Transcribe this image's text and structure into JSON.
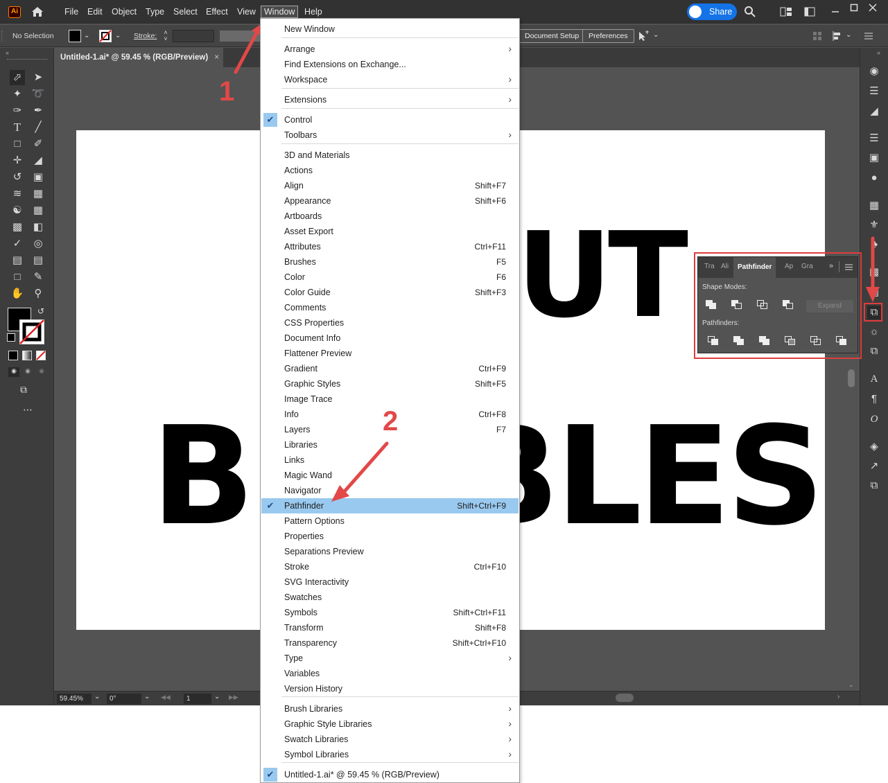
{
  "app": {
    "logo": "Ai",
    "menus": [
      "File",
      "Edit",
      "Object",
      "Type",
      "Select",
      "Effect",
      "View",
      "Window",
      "Help"
    ],
    "share_label": "Share"
  },
  "control_bar": {
    "selection": "No Selection",
    "stroke_label": "Stroke:",
    "document_setup": "Document Setup",
    "preferences": "Preferences"
  },
  "document": {
    "tab_title": "Untitled-1.ai* @ 59.45 % (RGB/Preview)",
    "art_word_top": "UT",
    "art_word_bottom": "BUBBLES"
  },
  "status_bar": {
    "zoom": "59.45%",
    "rotation": "0°",
    "artboard": "1"
  },
  "pathfinder_panel": {
    "tabs": [
      "Tra",
      "Ali",
      "Pathfinder",
      "Ap",
      "Gra"
    ],
    "shape_modes_label": "Shape Modes:",
    "pathfinders_label": "Pathfinders:",
    "expand_label": "Expand"
  },
  "window_menu": {
    "items": [
      {
        "label": "New Window"
      },
      {
        "label": "Arrange",
        "submenu": true
      },
      {
        "label": "Find Extensions on Exchange..."
      },
      {
        "label": "Workspace",
        "submenu": true
      },
      {
        "label": "Extensions",
        "submenu": true
      },
      {
        "label": "Control",
        "checked": true
      },
      {
        "label": "Toolbars",
        "submenu": true
      },
      {
        "label": "3D and Materials"
      },
      {
        "label": "Actions"
      },
      {
        "label": "Align",
        "shortcut": "Shift+F7"
      },
      {
        "label": "Appearance",
        "shortcut": "Shift+F6"
      },
      {
        "label": "Artboards"
      },
      {
        "label": "Asset Export"
      },
      {
        "label": "Attributes",
        "shortcut": "Ctrl+F11"
      },
      {
        "label": "Brushes",
        "shortcut": "F5"
      },
      {
        "label": "Color",
        "shortcut": "F6"
      },
      {
        "label": "Color Guide",
        "shortcut": "Shift+F3"
      },
      {
        "label": "Comments"
      },
      {
        "label": "CSS Properties"
      },
      {
        "label": "Document Info"
      },
      {
        "label": "Flattener Preview"
      },
      {
        "label": "Gradient",
        "shortcut": "Ctrl+F9"
      },
      {
        "label": "Graphic Styles",
        "shortcut": "Shift+F5"
      },
      {
        "label": "Image Trace"
      },
      {
        "label": "Info",
        "shortcut": "Ctrl+F8"
      },
      {
        "label": "Layers",
        "shortcut": "F7"
      },
      {
        "label": "Libraries"
      },
      {
        "label": "Links"
      },
      {
        "label": "Magic Wand"
      },
      {
        "label": "Navigator"
      },
      {
        "label": "Pathfinder",
        "shortcut": "Shift+Ctrl+F9",
        "checked": true,
        "highlighted": true
      },
      {
        "label": "Pattern Options"
      },
      {
        "label": "Properties"
      },
      {
        "label": "Separations Preview"
      },
      {
        "label": "Stroke",
        "shortcut": "Ctrl+F10"
      },
      {
        "label": "SVG Interactivity"
      },
      {
        "label": "Swatches"
      },
      {
        "label": "Symbols",
        "shortcut": "Shift+Ctrl+F11"
      },
      {
        "label": "Transform",
        "shortcut": "Shift+F8"
      },
      {
        "label": "Transparency",
        "shortcut": "Shift+Ctrl+F10"
      },
      {
        "label": "Type",
        "submenu": true
      },
      {
        "label": "Variables"
      },
      {
        "label": "Version History"
      },
      {
        "label": "Brush Libraries",
        "submenu": true
      },
      {
        "label": "Graphic Style Libraries",
        "submenu": true
      },
      {
        "label": "Swatch Libraries",
        "submenu": true
      },
      {
        "label": "Symbol Libraries",
        "submenu": true
      },
      {
        "label": "Untitled-1.ai* @ 59.45 % (RGB/Preview)",
        "checked": true
      }
    ]
  },
  "annotations": {
    "step1": "1",
    "step2": "2"
  },
  "colors": {
    "highlight": "#99c9ef",
    "annotation_red": "#e24848",
    "share_blue": "#1473e6"
  }
}
